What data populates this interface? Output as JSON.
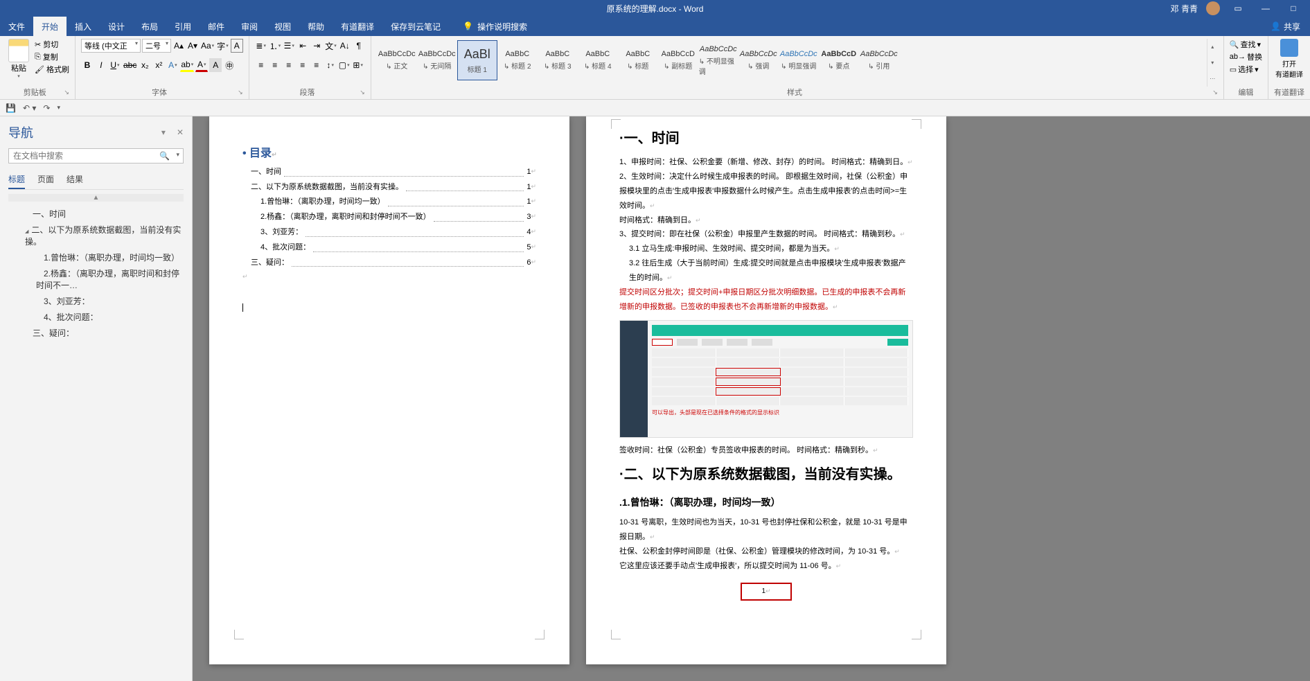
{
  "title": {
    "doc": "原系统的理解.docx",
    "app": "Word"
  },
  "user": "邓 青青",
  "share": "共享",
  "menus": [
    "文件",
    "开始",
    "插入",
    "设计",
    "布局",
    "引用",
    "邮件",
    "审阅",
    "视图",
    "帮助",
    "有道翻译",
    "保存到云笔记"
  ],
  "tellme": "操作说明搜索",
  "clipboard": {
    "paste": "粘贴",
    "cut": "剪切",
    "copy": "复制",
    "fmt": "格式刷",
    "label": "剪贴板"
  },
  "font": {
    "name": "等线 (中文正",
    "size": "二号",
    "label": "字体"
  },
  "para": {
    "label": "段落"
  },
  "styles": {
    "label": "样式",
    "items": [
      {
        "p": "AaBbCcDc",
        "n": "正文"
      },
      {
        "p": "AaBbCcDc",
        "n": "无间隔"
      },
      {
        "p": "AaBl",
        "n": "标题 1",
        "sel": true,
        "big": true
      },
      {
        "p": "AaBbC",
        "n": "标题 2"
      },
      {
        "p": "AaBbC",
        "n": "标题 3"
      },
      {
        "p": "AaBbC",
        "n": "标题 4"
      },
      {
        "p": "AaBbC",
        "n": "标题"
      },
      {
        "p": "AaBbCcD",
        "n": "副标题"
      },
      {
        "p": "AaBbCcDc",
        "n": "不明显强调",
        "i": true
      },
      {
        "p": "AaBbCcDc",
        "n": "强调",
        "i": true
      },
      {
        "p": "AaBbCcDc",
        "n": "明显强调",
        "i": true,
        "c": "#2e74b5"
      },
      {
        "p": "AaBbCcD",
        "n": "要点",
        "b": true
      },
      {
        "p": "AaBbCcDc",
        "n": "引用",
        "i": true
      }
    ]
  },
  "editing": {
    "find": "查找",
    "replace": "替换",
    "select": "选择",
    "label": "编辑"
  },
  "translate": {
    "open": "打开",
    "app": "有道翻译"
  },
  "nav": {
    "title": "导航",
    "placeholder": "在文档中搜索",
    "tabs": [
      "标题",
      "页面",
      "结果"
    ],
    "tree": [
      {
        "t": "一、时间",
        "lvl": 0
      },
      {
        "t": "二、以下为原系统数据截图，当前没有实操。",
        "lvl": 0,
        "exp": true
      },
      {
        "t": "1.曾怡琳：（离职办理，时间均一致）",
        "lvl": 1
      },
      {
        "t": "2.杨鑫：（离职办理，离职时间和封停时间不一…",
        "lvl": 1
      },
      {
        "t": "3、刘亚芳：",
        "lvl": 1
      },
      {
        "t": "4、批次问题：",
        "lvl": 1
      },
      {
        "t": "三、疑问：",
        "lvl": 0
      }
    ]
  },
  "page1": {
    "toc_title": "目录",
    "lines": [
      {
        "t": "一、时间",
        "p": "1",
        "l": 1
      },
      {
        "t": "二、以下为原系统数据截图，当前没有实操。",
        "p": "1",
        "l": 1
      },
      {
        "t": "1.曾怡琳：（离职办理，时间均一致）",
        "p": "1",
        "l": 2
      },
      {
        "t": "2.杨鑫：（离职办理，离职时间和封停时间不一致）",
        "p": "3",
        "l": 2
      },
      {
        "t": "3、刘亚芳：",
        "p": "4",
        "l": 2
      },
      {
        "t": "4、批次问题：",
        "p": "5",
        "l": 2
      },
      {
        "t": "三、疑问：",
        "p": "6",
        "l": 1
      }
    ]
  },
  "page2": {
    "h1_1": "·一、时间",
    "p1": "1、申报时间：社保、公积金要（新增、修改、封存）的时间。 时间格式：精确到日。",
    "p2": "2、生效时间：决定什么时候生成申报表的时间。 即根据生效时间，社保（公积金）申报模块里的点击'生成申报表'申报数据什么时候产生。点击生成申报表'的点击时间>=生效时间。",
    "p2b": "时间格式：精确到日。",
    "p3": "3、提交时间：即在社保（公积金）申报里产生数据的时间。 时间格式：精确到秒。",
    "p3a": "3.1 立马生成:申报时间、生效时间、提交时间，都是为当天。",
    "p3b": "3.2 往后生成（大于当前时间）生成:提交时间就是点击申报模块'生成申报表'数据产生的时间。",
    "red": "提交时间区分批次；提交时间+申报日期区分批次明细数据。已生成的申报表不会再新增新的申报数据。已签收的申报表也不会再新增新的申报数据。",
    "p4": "签收时间：社保（公积金）专员签收申报表的时间。 时间格式：精确到秒。",
    "h1_2": "·二、以下为原系统数据截图，当前没有实操。",
    "h2": ".1.曾怡琳：（离职办理，时间均一致）",
    "p5": "10-31 号离职，生效时间也为当天，10-31 号也封停社保和公积金，就是 10-31 号是申报日期。",
    "p6": "社保、公积金封停时间即是（社保、公积金）管理模块的修改时间，为 10-31 号。",
    "p7": "它这里应该还要手动点'生成申报表'，所以提交时间为 11-06 号。",
    "pagenum": "1"
  }
}
